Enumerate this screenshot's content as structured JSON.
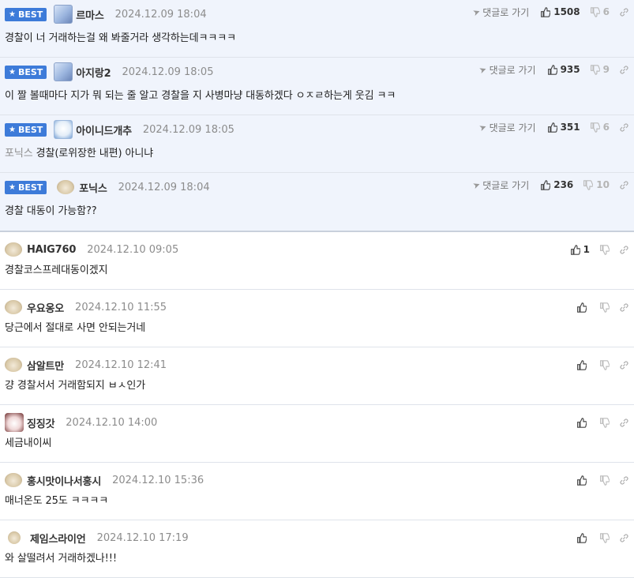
{
  "labels": {
    "best": "BEST",
    "reply": "댓글로 가기"
  },
  "best_comments": [
    {
      "nick": "르마스",
      "date": "2024.12.09 18:04",
      "likes": "1508",
      "dislikes": "6",
      "text": "경찰이 너 거래하는걸 왜 봐줄거라 생각하는데ㅋㅋㅋㅋ",
      "avatar": "robot-avatar"
    },
    {
      "nick": "아지랑2",
      "date": "2024.12.09 18:05",
      "likes": "935",
      "dislikes": "9",
      "text": "이 짤 볼때마다 지가 뭐 되는 줄 알고 경찰을 지 사병마냥 대동하겠다 ㅇㅈㄹ하는게 웃김 ㅋㅋ",
      "avatar": "robot-avatar"
    },
    {
      "nick": "아이니드개추",
      "date": "2024.12.09 18:05",
      "likes": "351",
      "dislikes": "6",
      "tag": "포닉스",
      "text": "경찰(로위장한 내편) 아니냐",
      "avatar": "baby-avatar"
    },
    {
      "nick": "포닉스",
      "date": "2024.12.09 18:04",
      "likes": "236",
      "dislikes": "10",
      "text": "경찰 대동이 가능함??",
      "avatar": "puppy-avatar"
    }
  ],
  "comments": [
    {
      "nick": "HAIG760",
      "date": "2024.12.10 09:05",
      "likes": "1",
      "text": "경찰코스프레대동이겠지",
      "avatar": "puppy-avatar"
    },
    {
      "nick": "우요옹오",
      "date": "2024.12.10 11:55",
      "likes": "",
      "text": "당근에서 절대로 사면 안되는거네",
      "avatar": "puppy-avatar"
    },
    {
      "nick": "삼알트만",
      "date": "2024.12.10 12:41",
      "likes": "",
      "text": "걍 경찰서서 거래함되지 ㅂㅅ인가",
      "avatar": "puppy-avatar"
    },
    {
      "nick": "징징갓",
      "date": "2024.12.10 14:00",
      "likes": "",
      "text": "세금내이씨",
      "avatar": "dog-avatar"
    },
    {
      "nick": "홍시맛이나서홍시",
      "date": "2024.12.10 15:36",
      "likes": "",
      "text": "매너온도 25도 ㅋㅋㅋㅋ",
      "avatar": "puppy-avatar"
    },
    {
      "nick": "제임스라이언",
      "date": "2024.12.10 17:19",
      "likes": "",
      "text": "와 살떨려서 거래하겠나!!!",
      "avatar": "puppy-avatar"
    }
  ],
  "colors": {
    "best_badge": "#3d7bd9",
    "best_background": "#f0f4fc"
  }
}
